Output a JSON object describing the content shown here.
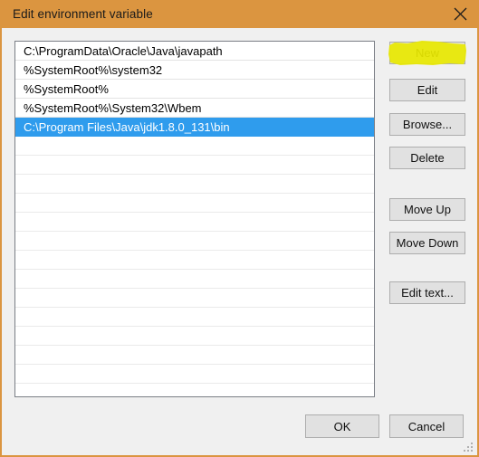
{
  "window": {
    "title": "Edit environment variable",
    "close_icon": "close-icon",
    "titlebar_color": "#db9540",
    "border_color": "#db9540",
    "body_color": "#f0f0f0"
  },
  "list": {
    "selected_index": 4,
    "selection_color": "#2f9ced",
    "entries": [
      "C:\\ProgramData\\Oracle\\Java\\javapath",
      "%SystemRoot%\\system32",
      "%SystemRoot%",
      "%SystemRoot%\\System32\\Wbem",
      "C:\\Program Files\\Java\\jdk1.8.0_131\\bin"
    ],
    "empty_row_count": 13
  },
  "side_buttons": {
    "new": "New",
    "edit": "Edit",
    "browse": "Browse...",
    "delete": "Delete",
    "move_up": "Move Up",
    "move_down": "Move Down",
    "edit_text": "Edit text..."
  },
  "annotation": {
    "highlight_target": "New",
    "highlight_color": "#e8e800"
  },
  "bottom_buttons": {
    "ok": "OK",
    "cancel": "Cancel"
  }
}
